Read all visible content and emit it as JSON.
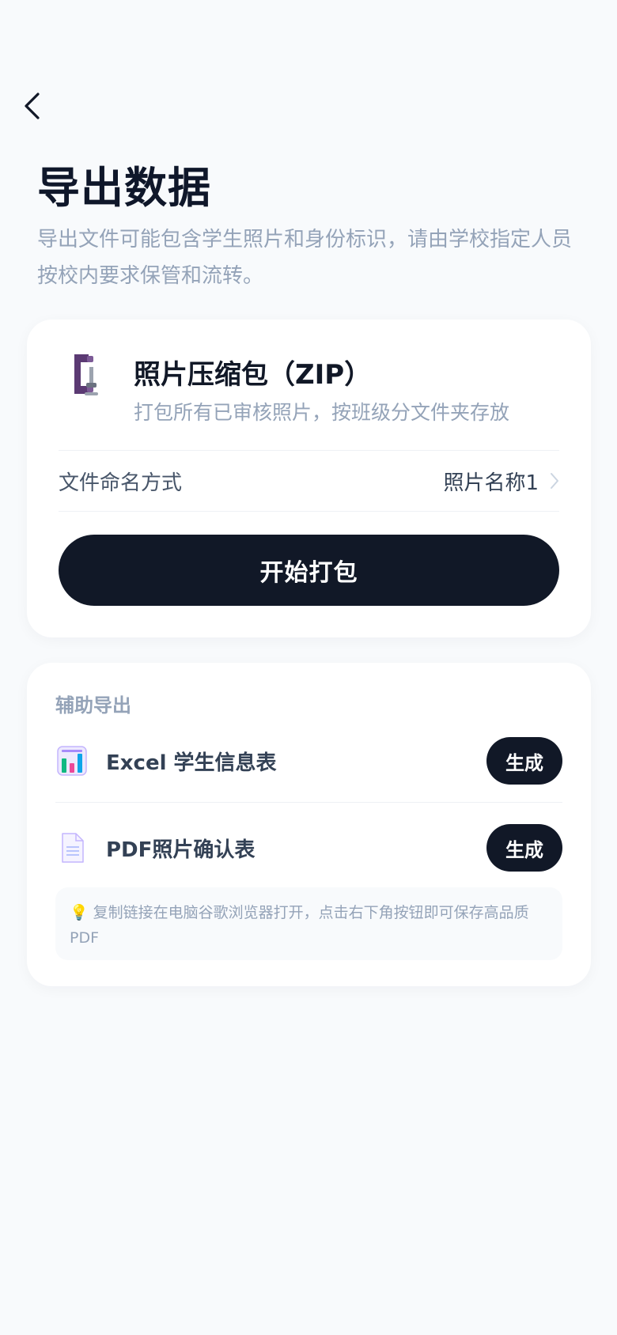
{
  "header": {
    "title": "导出数据",
    "subtitle": "导出文件可能包含学生照片和身份标识，请由学校指定人员按校内要求保管和流转。"
  },
  "zip_card": {
    "title": "照片压缩包（ZIP）",
    "description": "打包所有已审核照片，按班级分文件夹存放",
    "naming_label": "文件命名方式",
    "naming_value": "照片名称1",
    "start_button": "开始打包"
  },
  "aux_card": {
    "section_label": "辅助导出",
    "items": [
      {
        "label": "Excel 学生信息表",
        "button": "生成",
        "icon": "spreadsheet-icon"
      },
      {
        "label": "PDF照片确认表",
        "button": "生成",
        "icon": "document-icon"
      }
    ],
    "tip": "复制链接在电脑谷歌浏览器打开，点击右下角按钮即可保存高品质 PDF",
    "tip_icon": "💡"
  },
  "colors": {
    "primary": "#111827",
    "muted": "#94a3b8",
    "background": "#f8fafc"
  }
}
